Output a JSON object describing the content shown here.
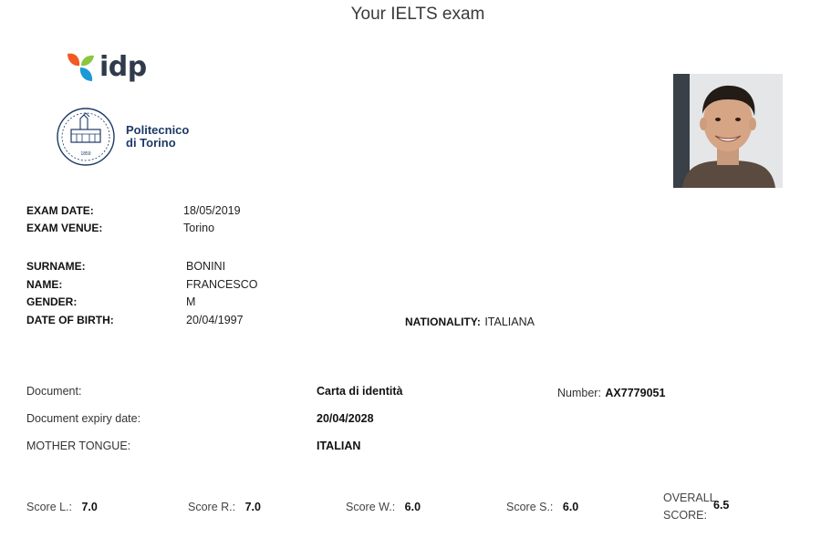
{
  "page_title": "Your IELTS exam",
  "logos": {
    "idp_text": "idp",
    "polito_line1": "Politecnico",
    "polito_line2": "di Torino",
    "polito_seal_year": "1859"
  },
  "exam": {
    "date_label": "EXAM DATE:",
    "date_value": "18/05/2019",
    "venue_label": "EXAM VENUE:",
    "venue_value": "Torino"
  },
  "candidate": {
    "surname_label": "SURNAME:",
    "surname_value": "BONINI",
    "name_label": "NAME:",
    "name_value": "FRANCESCO",
    "gender_label": "GENDER:",
    "gender_value": "M",
    "dob_label": "DATE OF BIRTH:",
    "dob_value": "20/04/1997",
    "nationality_label": "NATIONALITY:",
    "nationality_value": "ITALIANA"
  },
  "document": {
    "doc_label": "Document:",
    "doc_value": "Carta di identità",
    "number_label": "Number:",
    "number_value": "AX7779051",
    "expiry_label": "Document expiry date:",
    "expiry_value": "20/04/2028",
    "tongue_label": "MOTHER TONGUE:",
    "tongue_value": "ITALIAN"
  },
  "scores": {
    "l_label": "Score L.:",
    "l_value": "7.0",
    "r_label": "Score R.:",
    "r_value": "7.0",
    "w_label": "Score W.:",
    "w_value": "6.0",
    "s_label": "Score S.:",
    "s_value": "6.0",
    "overall_label_1": "OVERALL",
    "overall_label_2": "SCORE:",
    "overall_value": "6.5"
  },
  "colors": {
    "idp_orange": "#f15a22",
    "idp_green": "#8cc63f",
    "idp_blue": "#1c9ad6",
    "polito_navy": "#1d3a66"
  },
  "icons": {
    "idp_mark": "idp-pinwheel-icon",
    "polito_seal": "polito-seal-icon",
    "photo": "candidate-photo"
  }
}
